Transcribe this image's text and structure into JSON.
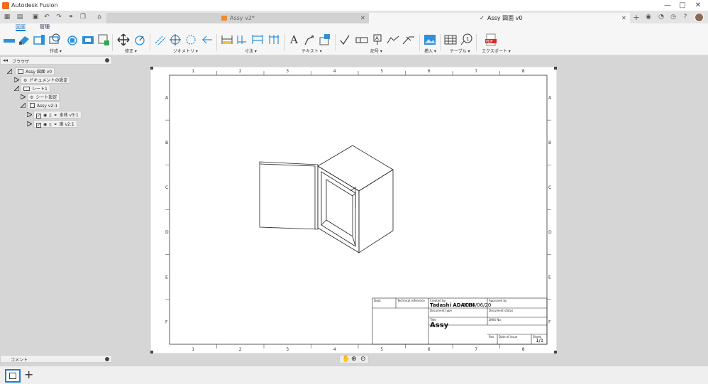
{
  "app": {
    "title": "Autodesk Fusion"
  },
  "tabs": [
    {
      "label": "Assy v2*",
      "active": false
    },
    {
      "label": "Assy 図面 v0",
      "active": true
    }
  ],
  "ribbon_tabs": [
    "図面",
    "管理"
  ],
  "ribbon_groups": [
    "作成",
    "修正",
    "ジオメトリ",
    "寸法",
    "テキスト",
    "記号",
    "挿入",
    "テーブル",
    "エクスポート"
  ],
  "browser": {
    "title": "ブラウザ",
    "tree": [
      {
        "label": "Assy 図面 v0"
      },
      {
        "label": "ドキュメントの設定"
      },
      {
        "label": "シート1"
      },
      {
        "label": "シート設定"
      },
      {
        "label": "Assy v2:1"
      },
      {
        "label": "本体 v3:1"
      },
      {
        "label": "扉 v2:1"
      }
    ]
  },
  "comments": {
    "label": "コメント"
  },
  "sheet": {
    "col_labels": [
      "1",
      "2",
      "3",
      "4",
      "5",
      "6",
      "7",
      "8"
    ],
    "row_labels": [
      "A",
      "B",
      "C",
      "D",
      "E",
      "F"
    ]
  },
  "title_block": {
    "dept_label": "Dept.",
    "tech_ref_label": "Technical reference",
    "created_by_label": "Created by",
    "created_by": "Tadashi ADACHI",
    "date": "2024/06/20",
    "approved_by_label": "Approved by",
    "doc_type_label": "Document type",
    "doc_status_label": "Document status",
    "title_label": "Title",
    "title": "Assy",
    "dwg_no_label": "DWG No.",
    "rev_label": "Rev.",
    "date_of_issue_label": "Date of issue",
    "sheet_label": "Sheet",
    "sheet_value": "1/1"
  },
  "colors": {
    "accent": "#1e7bd4",
    "fusion_orange": "#f26b1d",
    "workspace": "#d6d6d6"
  }
}
